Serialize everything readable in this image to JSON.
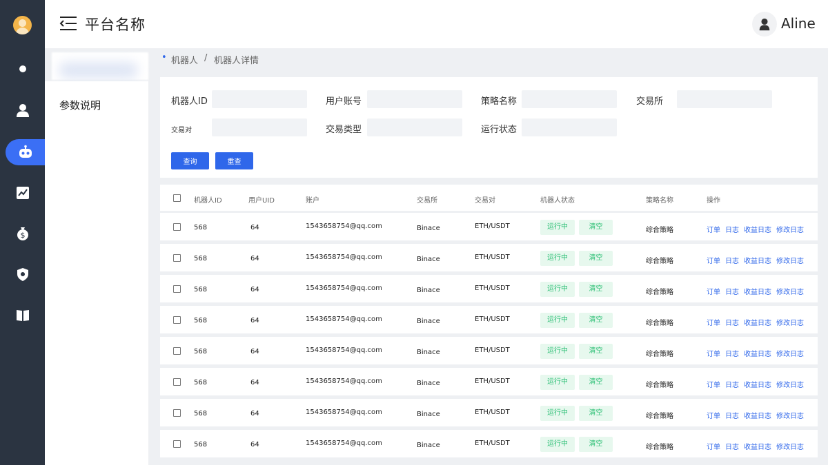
{
  "header": {
    "title": "平台名称",
    "user_name": "Aline"
  },
  "sidebar": {
    "icons": [
      "user-avatar-icon",
      "dot-icon",
      "person-icon",
      "robot-icon",
      "chart-icon",
      "money-bag-icon",
      "shield-icon",
      "book-icon"
    ],
    "active": "robot-icon"
  },
  "submenu": {
    "item": "参数说明"
  },
  "breadcrumb": [
    "机器人",
    "机器人详情"
  ],
  "filters": {
    "robot_id": {
      "label": "机器人ID",
      "value": ""
    },
    "user_account": {
      "label": "用户账号",
      "value": ""
    },
    "strategy_name": {
      "label": "策略名称",
      "value": ""
    },
    "exchange": {
      "label": "交易所",
      "value": ""
    },
    "pair": {
      "label": "交易对",
      "value": ""
    },
    "trade_type": {
      "label": "交易类型",
      "value": ""
    },
    "run_status": {
      "label": "运行状态",
      "value": ""
    },
    "query_button": "查询",
    "reset_button": "重查"
  },
  "table": {
    "columns": [
      "机器人ID",
      "用户UID",
      "账户",
      "交易所",
      "交易对",
      "机器人状态",
      "策略名称",
      "操作"
    ],
    "actions": [
      "订单",
      "日志",
      "收益日志",
      "修改日志"
    ],
    "rows": [
      {
        "robot_id": "568",
        "uid": "64",
        "account": "1543658754@qq.com",
        "exchange": "Binace",
        "pair": "ETH/USDT",
        "status": "运行中",
        "clear": "清空",
        "strategy": "综合策略"
      },
      {
        "robot_id": "568",
        "uid": "64",
        "account": "1543658754@qq.com",
        "exchange": "Binace",
        "pair": "ETH/USDT",
        "status": "运行中",
        "clear": "清空",
        "strategy": "综合策略"
      },
      {
        "robot_id": "568",
        "uid": "64",
        "account": "1543658754@qq.com",
        "exchange": "Binace",
        "pair": "ETH/USDT",
        "status": "运行中",
        "clear": "清空",
        "strategy": "综合策略"
      },
      {
        "robot_id": "568",
        "uid": "64",
        "account": "1543658754@qq.com",
        "exchange": "Binace",
        "pair": "ETH/USDT",
        "status": "运行中",
        "clear": "清空",
        "strategy": "综合策略"
      },
      {
        "robot_id": "568",
        "uid": "64",
        "account": "1543658754@qq.com",
        "exchange": "Binace",
        "pair": "ETH/USDT",
        "status": "运行中",
        "clear": "清空",
        "strategy": "综合策略"
      },
      {
        "robot_id": "568",
        "uid": "64",
        "account": "1543658754@qq.com",
        "exchange": "Binace",
        "pair": "ETH/USDT",
        "status": "运行中",
        "clear": "清空",
        "strategy": "综合策略"
      },
      {
        "robot_id": "568",
        "uid": "64",
        "account": "1543658754@qq.com",
        "exchange": "Binace",
        "pair": "ETH/USDT",
        "status": "运行中",
        "clear": "清空",
        "strategy": "综合策略"
      },
      {
        "robot_id": "568",
        "uid": "64",
        "account": "1543658754@qq.com",
        "exchange": "Binace",
        "pair": "ETH/USDT",
        "status": "运行中",
        "clear": "清空",
        "strategy": "综合策略"
      }
    ]
  },
  "colors": {
    "accent": "#2f67ea",
    "sidebar_bg": "#2b3441",
    "status_green": "#2cbf75",
    "status_green_bg": "#e7f8ee"
  }
}
